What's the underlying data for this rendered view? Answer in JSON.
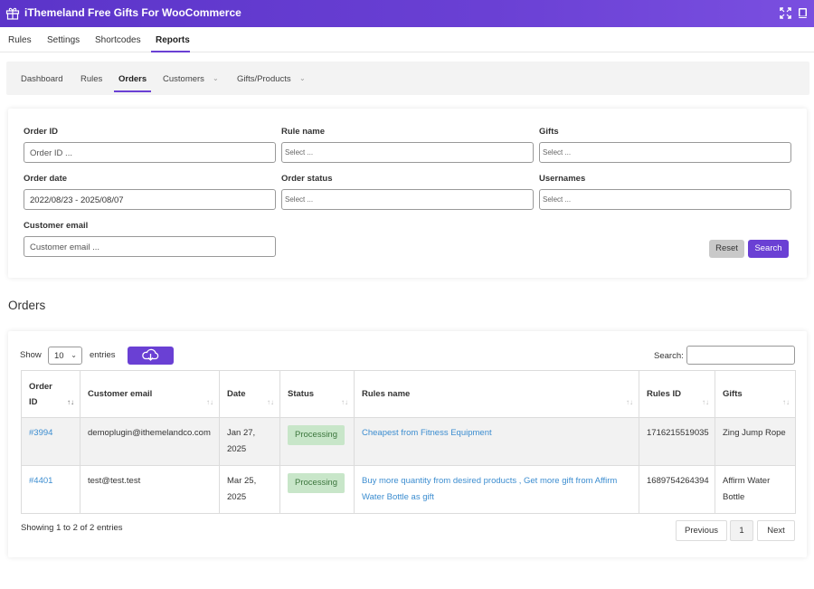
{
  "app": {
    "title": "iThemeland Free Gifts For WooCommerce"
  },
  "main_nav": [
    {
      "label": "Rules"
    },
    {
      "label": "Settings"
    },
    {
      "label": "Shortcodes"
    },
    {
      "label": "Reports"
    }
  ],
  "sub_nav": [
    {
      "label": "Dashboard"
    },
    {
      "label": "Rules"
    },
    {
      "label": "Orders"
    },
    {
      "label": "Customers"
    },
    {
      "label": "Gifts/Products"
    }
  ],
  "filters": {
    "order_id_label": "Order ID",
    "order_id_placeholder": "Order ID ...",
    "rule_name_label": "Rule name",
    "rule_name_placeholder": "Select ...",
    "gifts_label": "Gifts",
    "gifts_placeholder": "Select ...",
    "order_date_label": "Order date",
    "order_date_value": "2022/08/23 - 2025/08/07",
    "order_status_label": "Order status",
    "order_status_placeholder": "Select ...",
    "usernames_label": "Usernames",
    "usernames_placeholder": "Select ...",
    "customer_email_label": "Customer email",
    "customer_email_placeholder": "Customer email ...",
    "reset_label": "Reset",
    "search_label": "Search"
  },
  "orders": {
    "title": "Orders",
    "show_label": "Show",
    "entries_value": "10",
    "entries_label": "entries",
    "search_label": "Search:",
    "columns": [
      "Order ID",
      "Customer email",
      "Date",
      "Status",
      "Rules name",
      "Rules ID",
      "Gifts"
    ],
    "rows": [
      {
        "order_id": "#3994",
        "email": "demoplugin@ithemelandco.com",
        "date": "Jan 27, 2025",
        "status": "Processing",
        "rules_name": "Cheapest from Fitness Equipment",
        "rules_id": "1716215519035",
        "gifts": "Zing Jump Rope"
      },
      {
        "order_id": "#4401",
        "email": "test@test.test",
        "date": "Mar 25, 2025",
        "status": "Processing",
        "rules_name": "Buy more quantity from desired products , Get more gift from Affirm Water Bottle as gift",
        "rules_id": "1689754264394",
        "gifts": "Affirm Water Bottle"
      }
    ],
    "showing_text": "Showing 1 to 2 of 2 entries",
    "pager": {
      "previous": "Previous",
      "page": "1",
      "next": "Next"
    }
  },
  "icons": {
    "logo": "gift-box-icon",
    "fullscreen": "fullscreen-icon",
    "docs": "book-icon",
    "download": "cloud-download-icon"
  },
  "colors": {
    "accent": "#6a40d4",
    "link": "#3c8dd0",
    "status_bg": "#c8e6c9"
  }
}
